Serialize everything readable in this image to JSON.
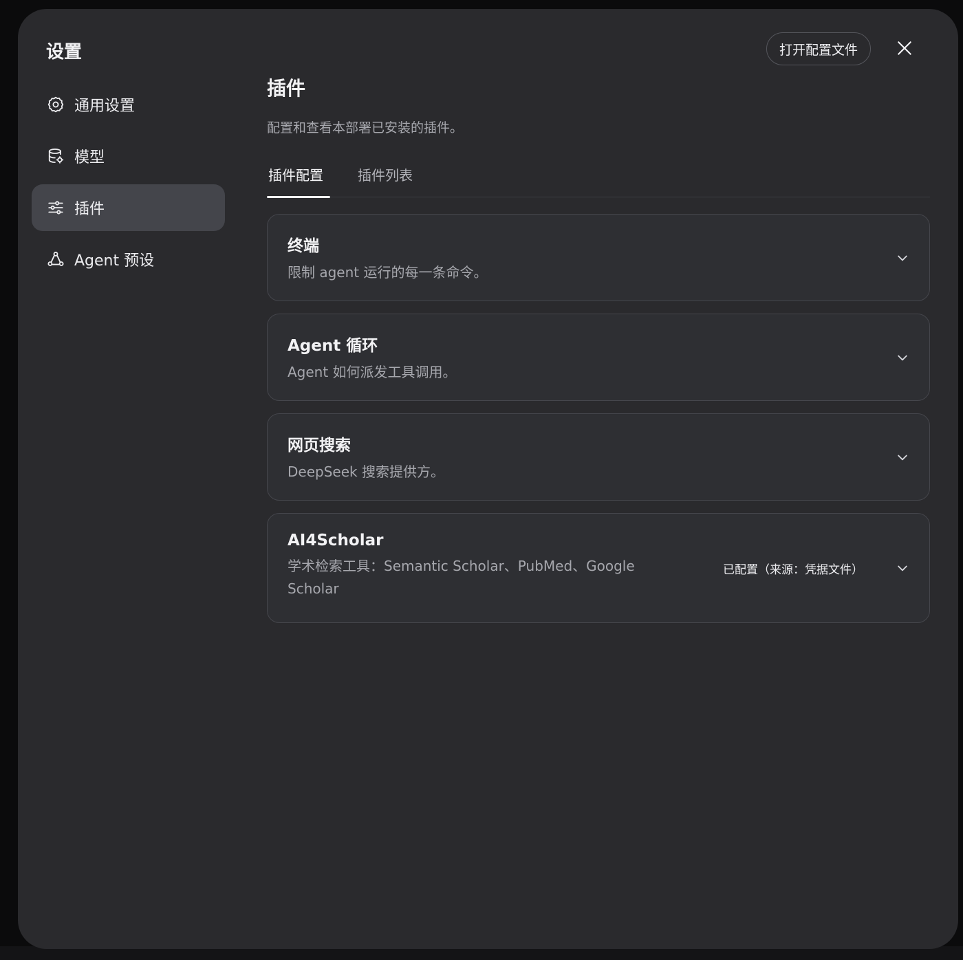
{
  "sidebar": {
    "title": "设置",
    "items": [
      {
        "label": "通用设置",
        "icon": "gear-icon",
        "active": false
      },
      {
        "label": "模型",
        "icon": "database-icon",
        "active": false
      },
      {
        "label": "插件",
        "icon": "sliders-icon",
        "active": true
      },
      {
        "label": "Agent 预设",
        "icon": "agent-icon",
        "active": false
      }
    ]
  },
  "header": {
    "open_config_label": "打开配置文件",
    "close_icon": "close-icon"
  },
  "main": {
    "title": "插件",
    "description": "配置和查看本部署已安装的插件。",
    "tabs": [
      {
        "label": "插件配置",
        "active": true
      },
      {
        "label": "插件列表",
        "active": false
      }
    ],
    "plugins": [
      {
        "title": "终端",
        "description": "限制 agent 运行的每一条命令。",
        "status": ""
      },
      {
        "title": "Agent 循环",
        "description": "Agent 如何派发工具调用。",
        "status": ""
      },
      {
        "title": "网页搜索",
        "description": "DeepSeek 搜索提供方。",
        "status": ""
      },
      {
        "title": "AI4Scholar",
        "description_line1": "学术检索工具：Semantic Scholar、PubMed、Google",
        "description_line2": "Scholar",
        "status": "已配置（来源：凭据文件）"
      }
    ]
  },
  "colors": {
    "modal_bg": "#2a2a2d",
    "active_nav_bg": "#44454b",
    "card_bg": "#2e2f33",
    "text_primary": "#f2f2f4",
    "text_secondary": "#a6a7ad"
  }
}
